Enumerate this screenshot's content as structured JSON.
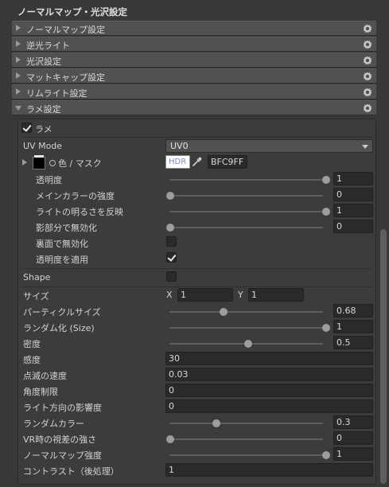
{
  "title": "ノーマルマップ・光沢設定",
  "folds": [
    {
      "label": "ノーマルマップ設定"
    },
    {
      "label": "逆光ライト"
    },
    {
      "label": "光沢設定"
    },
    {
      "label": "マットキャップ設定"
    },
    {
      "label": "リムライト設定"
    },
    {
      "label": "ラメ設定"
    }
  ],
  "glitter": {
    "enable_label": "ラメ",
    "uv_mode": {
      "label": "UV Mode",
      "value": "UV0"
    },
    "color_mask": {
      "label": "色 / マスク",
      "hdr": "HDR",
      "hex": "BFC9FF"
    },
    "alpha": {
      "label": "透明度",
      "value": "1",
      "frac": 1.0
    },
    "main_strength": {
      "label": "メインカラーの強度",
      "value": "0",
      "frac": 0.0
    },
    "normalize": {
      "label": "ライトの明るさを反映",
      "value": "1",
      "frac": 1.0
    },
    "shadow_mask": {
      "label": "影部分で無効化",
      "value": "0",
      "frac": 0.0
    },
    "backface": {
      "label": "裏面で無効化",
      "checked": false
    },
    "apply_transparency": {
      "label": "透明度を適用",
      "checked": true
    },
    "shape": {
      "label": "Shape",
      "checked": false
    },
    "size": {
      "label": "サイズ",
      "x_label": "X",
      "x": "1",
      "y_label": "Y",
      "y": "1"
    },
    "particle_size": {
      "label": "パーティクルサイズ",
      "value": "0.68",
      "frac": 0.34
    },
    "randomize_size": {
      "label": "ランダム化 (Size)",
      "value": "1",
      "frac": 1.0
    },
    "density": {
      "label": "密度",
      "value": "0.5",
      "frac": 0.5
    },
    "sensitivity": {
      "label": "感度",
      "value": "30"
    },
    "blink_speed": {
      "label": "点滅の速度",
      "value": "0.03"
    },
    "angle_limit": {
      "label": "角度制限",
      "value": "0"
    },
    "light_direction": {
      "label": "ライト方向の影響度",
      "value": "0"
    },
    "random_color": {
      "label": "ランダムカラー",
      "value": "0.3",
      "frac": 0.3
    },
    "vr_parallax": {
      "label": "VR時の視差の強さ",
      "value": "0",
      "frac": 0.0
    },
    "normal_strength": {
      "label": "ノーマルマップ強度",
      "value": "1",
      "frac": 1.0
    },
    "contrast": {
      "label": "コントラスト（後処理）",
      "value": "1"
    }
  },
  "colors": {
    "swatch": "#ffffff",
    "hdr_text": "#7a8cc8"
  }
}
